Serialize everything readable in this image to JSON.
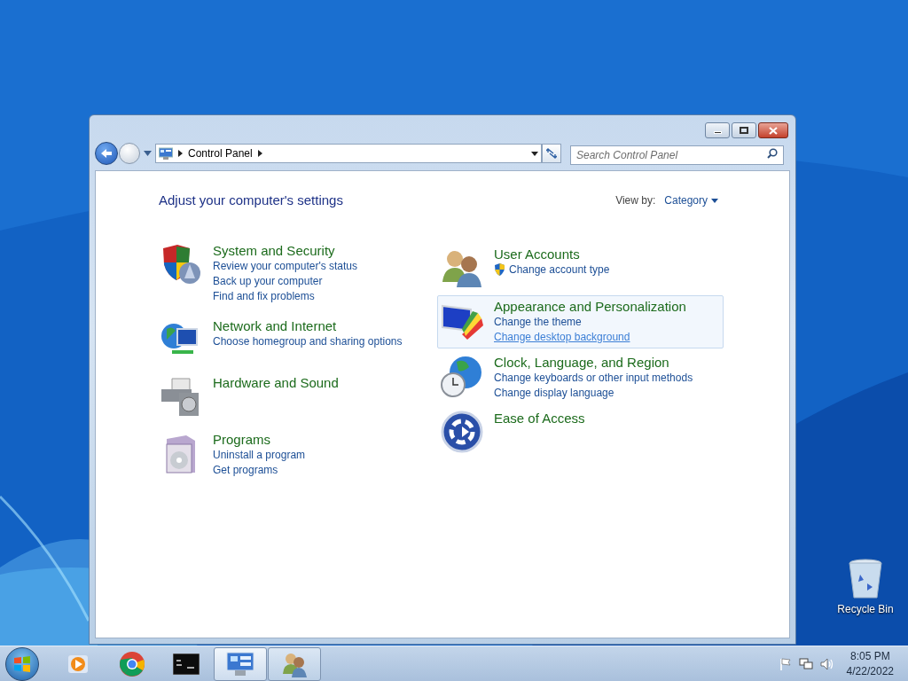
{
  "window": {
    "breadcrumb": "Control Panel",
    "search": {
      "placeholder": "Search Control Panel"
    },
    "heading": "Adjust your computer's settings",
    "view_by": {
      "label": "View by:",
      "value": "Category"
    }
  },
  "columns": [
    [
      {
        "kind": "security",
        "title": "System and Security",
        "highlighted": false,
        "links": [
          {
            "text": "Review your computer's status",
            "hovered": false,
            "shield": false
          },
          {
            "text": "Back up your computer",
            "hovered": false,
            "shield": false
          },
          {
            "text": "Find and fix problems",
            "hovered": false,
            "shield": false
          }
        ]
      },
      {
        "kind": "network",
        "title": "Network and Internet",
        "highlighted": false,
        "links": [
          {
            "text": "Choose homegroup and sharing options",
            "hovered": false,
            "shield": false
          }
        ]
      },
      {
        "kind": "hardware",
        "title": "Hardware and Sound",
        "highlighted": false
      },
      {
        "kind": "programs",
        "title": "Programs",
        "highlighted": false,
        "links": [
          {
            "text": "Uninstall a program",
            "hovered": false,
            "shield": false
          },
          {
            "text": "Get programs",
            "hovered": false,
            "shield": false
          }
        ]
      }
    ],
    [
      {
        "kind": "users",
        "title": "User Accounts",
        "highlighted": false,
        "links": [
          {
            "text": "Change account type",
            "hovered": false,
            "shield": true
          }
        ]
      },
      {
        "kind": "appearance",
        "title": "Appearance and Personalization",
        "highlighted": true,
        "links": [
          {
            "text": "Change the theme",
            "hovered": false,
            "shield": false
          },
          {
            "text": "Change desktop background",
            "hovered": true,
            "shield": false
          }
        ]
      },
      {
        "kind": "clock",
        "title": "Clock, Language, and Region",
        "highlighted": false,
        "links": [
          {
            "text": "Change keyboards or other input methods",
            "hovered": false,
            "shield": false
          },
          {
            "text": "Change display language",
            "hovered": false,
            "shield": false
          }
        ]
      },
      {
        "kind": "ease",
        "title": "Ease of Access",
        "highlighted": false
      }
    ]
  ],
  "desktop_icons": [
    {
      "label": "Recycle Bin"
    }
  ],
  "taskbar": {
    "items": [
      {
        "kind": "media",
        "open": false,
        "selected": false
      },
      {
        "kind": "browser",
        "open": false,
        "selected": false
      },
      {
        "kind": "terminal",
        "open": false,
        "selected": false
      },
      {
        "kind": "control-panel",
        "open": true,
        "selected": true
      },
      {
        "kind": "users",
        "open": true,
        "selected": false
      }
    ],
    "clock": {
      "time": "8:05 PM",
      "date": "4/22/2022"
    }
  }
}
